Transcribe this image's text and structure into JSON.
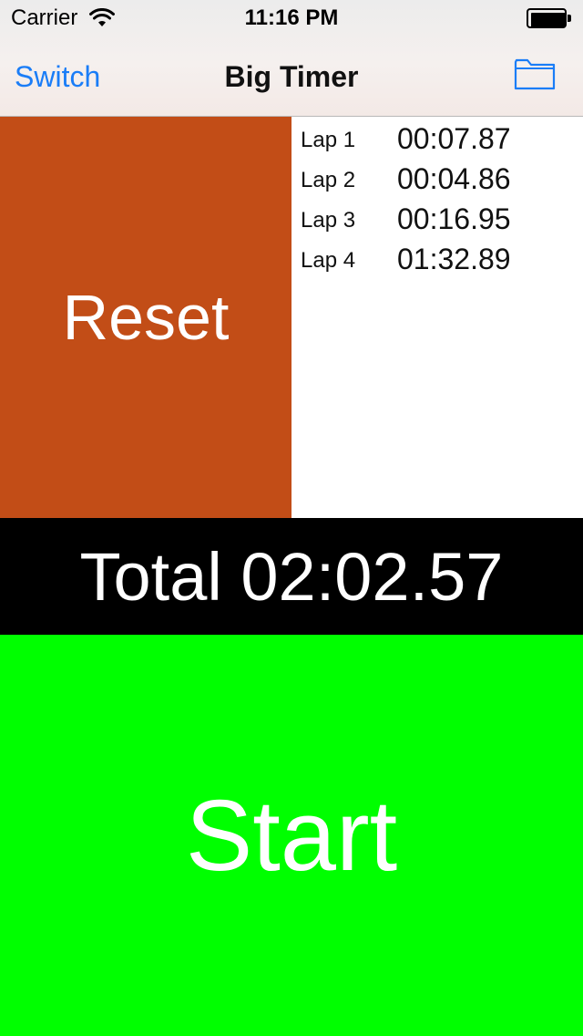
{
  "status_bar": {
    "carrier": "Carrier",
    "time": "11:16 PM",
    "wifi_icon": "wifi-icon",
    "battery_icon": "battery-icon"
  },
  "nav": {
    "left_button": "Switch",
    "title": "Big Timer",
    "right_icon": "folder-icon",
    "accent_color": "#1a7df7"
  },
  "reset": {
    "label": "Reset",
    "color": "#c24d17"
  },
  "laps": [
    {
      "name": "Lap 1",
      "time": "00:07.87"
    },
    {
      "name": "Lap 2",
      "time": "00:04.86"
    },
    {
      "name": "Lap 3",
      "time": "00:16.95"
    },
    {
      "name": "Lap 4",
      "time": "01:32.89"
    }
  ],
  "total": {
    "text": "Total 02:02.57",
    "color": "#000000"
  },
  "start": {
    "label": "Start",
    "color": "#00ff00"
  }
}
